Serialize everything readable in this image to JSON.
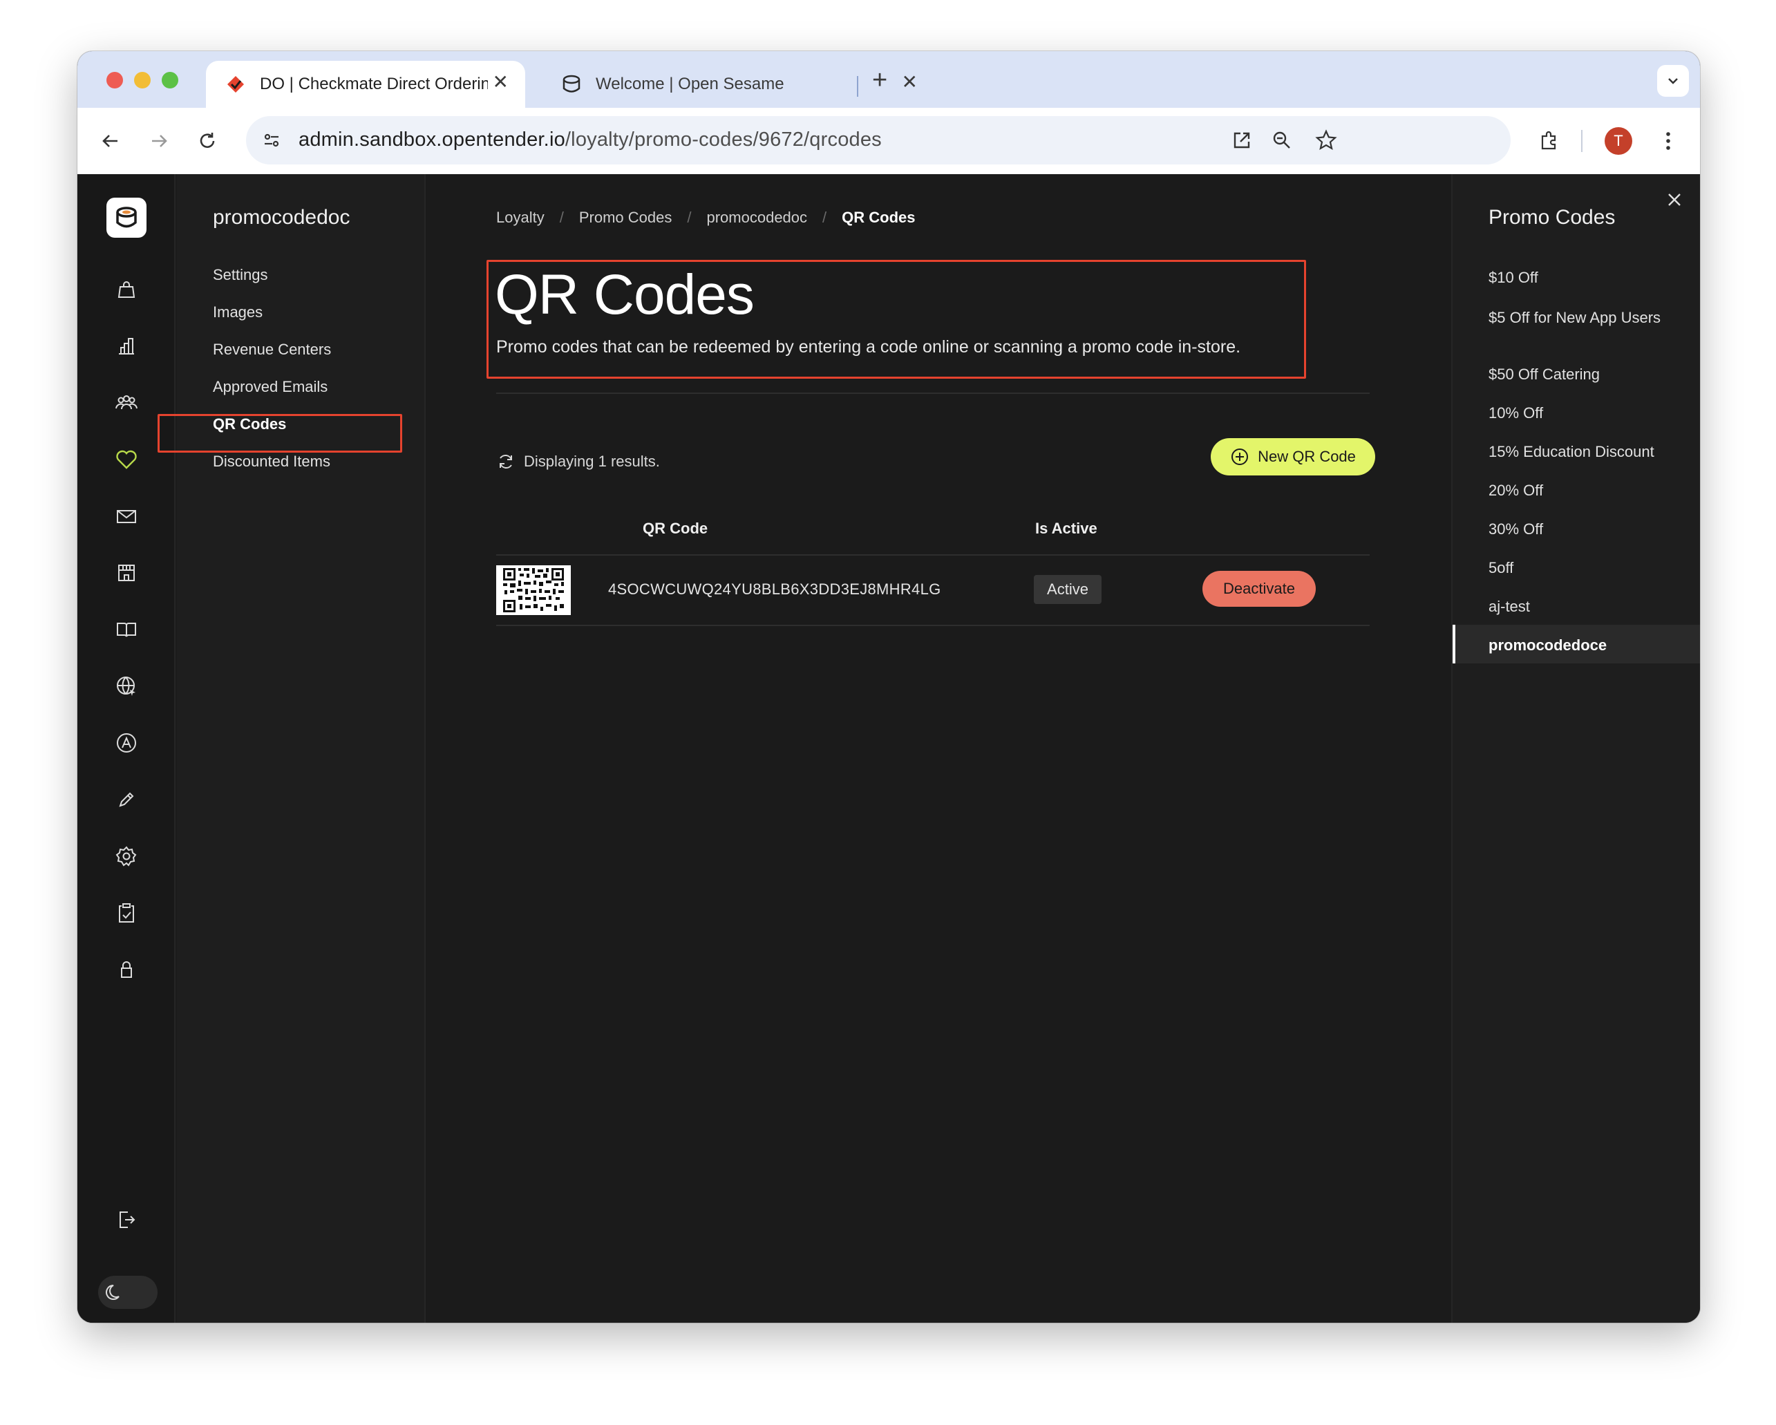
{
  "browser": {
    "tabs": [
      {
        "title": "DO | Checkmate Direct Ordering",
        "active": true
      },
      {
        "title": "Welcome | Open Sesame",
        "active": false
      }
    ],
    "url_host": "admin.sandbox.opentender.io",
    "url_path": "/loyalty/promo-codes/9672/qrcodes",
    "profile_initial": "T",
    "colors": {
      "tabstrip": "#dae3f6",
      "profile": "#c4402a"
    }
  },
  "icon_rail": {
    "icons": [
      "bag-icon",
      "chart-icon",
      "users-icon",
      "heart-icon",
      "mail-icon",
      "store-icon",
      "book-icon",
      "globe-icon",
      "app-store-icon",
      "pencil-icon",
      "gear-icon",
      "clipboard-icon",
      "lock-icon",
      "logout-icon",
      "moon-icon"
    ],
    "active_color": "#b8d94a"
  },
  "subnav": {
    "title": "promocodedoc",
    "items": [
      {
        "label": "Settings"
      },
      {
        "label": "Images"
      },
      {
        "label": "Revenue Centers"
      },
      {
        "label": "Approved Emails"
      },
      {
        "label": "QR Codes"
      },
      {
        "label": "Discounted Items"
      }
    ],
    "selected": "QR Codes"
  },
  "breadcrumb": [
    {
      "label": "Loyalty"
    },
    {
      "label": "Promo Codes"
    },
    {
      "label": "promocodedoc"
    },
    {
      "label": "QR Codes"
    }
  ],
  "page": {
    "title": "QR Codes",
    "subtitle": "Promo codes that can be redeemed by entering a code online or scanning a promo code in-store.",
    "results_text": "Displaying 1 results.",
    "new_button": "New QR Code",
    "accent": "#e3f56a",
    "highlight_color": "#e5432e"
  },
  "table": {
    "headers": {
      "qr_code": "QR Code",
      "is_active": "Is Active"
    },
    "rows": [
      {
        "code": "4SOCWCUWQ24YU8BLB6X3DD3EJ8MHR4LG",
        "status": "Active",
        "action": "Deactivate"
      }
    ],
    "action_color": "#ea7461"
  },
  "right_panel": {
    "title": "Promo Codes",
    "items": [
      {
        "label": "$10 Off"
      },
      {
        "label": "$5 Off for New App Users"
      },
      {
        "label": "$50 Off Catering"
      },
      {
        "label": "10% Off"
      },
      {
        "label": "15% Education Discount"
      },
      {
        "label": "20% Off"
      },
      {
        "label": "30% Off"
      },
      {
        "label": "5off"
      },
      {
        "label": "aj-test"
      },
      {
        "label": "promocodedoce"
      }
    ],
    "selected": "promocodedoce"
  }
}
